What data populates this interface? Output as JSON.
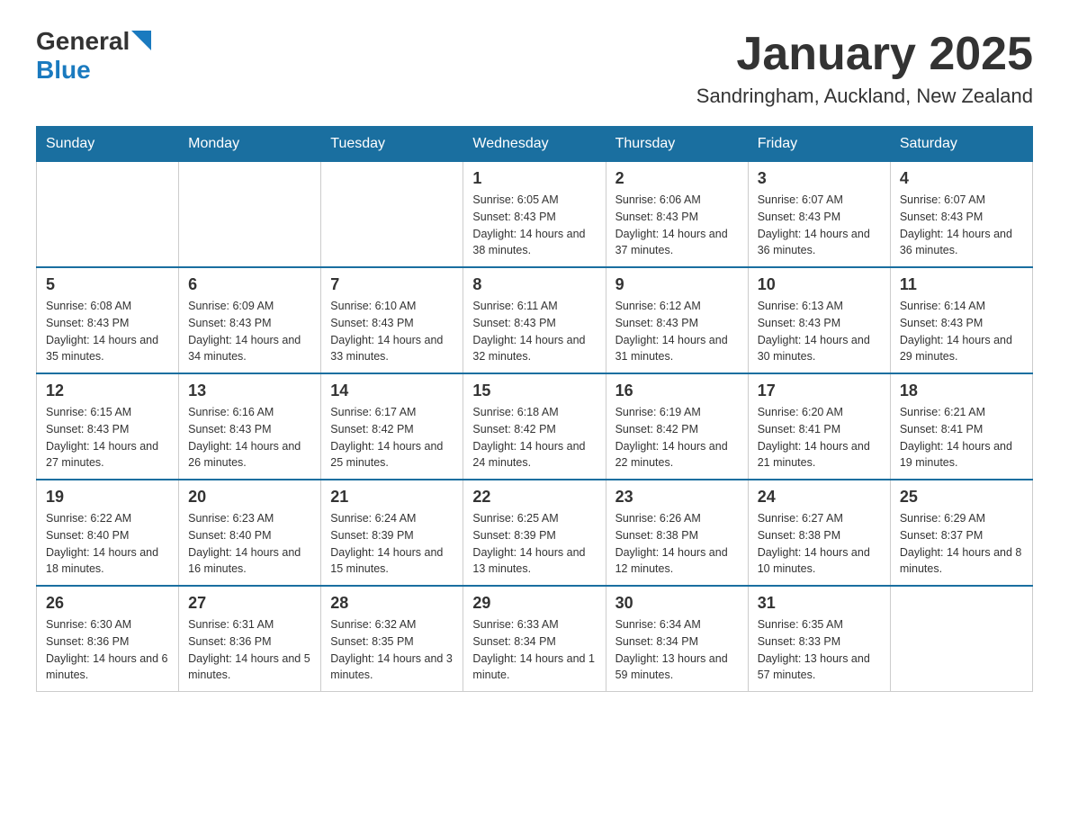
{
  "logo": {
    "general": "General",
    "blue": "Blue"
  },
  "title": "January 2025",
  "subtitle": "Sandringham, Auckland, New Zealand",
  "days": [
    "Sunday",
    "Monday",
    "Tuesday",
    "Wednesday",
    "Thursday",
    "Friday",
    "Saturday"
  ],
  "weeks": [
    [
      {
        "day": "",
        "info": ""
      },
      {
        "day": "",
        "info": ""
      },
      {
        "day": "",
        "info": ""
      },
      {
        "day": "1",
        "info": "Sunrise: 6:05 AM\nSunset: 8:43 PM\nDaylight: 14 hours and 38 minutes."
      },
      {
        "day": "2",
        "info": "Sunrise: 6:06 AM\nSunset: 8:43 PM\nDaylight: 14 hours and 37 minutes."
      },
      {
        "day": "3",
        "info": "Sunrise: 6:07 AM\nSunset: 8:43 PM\nDaylight: 14 hours and 36 minutes."
      },
      {
        "day": "4",
        "info": "Sunrise: 6:07 AM\nSunset: 8:43 PM\nDaylight: 14 hours and 36 minutes."
      }
    ],
    [
      {
        "day": "5",
        "info": "Sunrise: 6:08 AM\nSunset: 8:43 PM\nDaylight: 14 hours and 35 minutes."
      },
      {
        "day": "6",
        "info": "Sunrise: 6:09 AM\nSunset: 8:43 PM\nDaylight: 14 hours and 34 minutes."
      },
      {
        "day": "7",
        "info": "Sunrise: 6:10 AM\nSunset: 8:43 PM\nDaylight: 14 hours and 33 minutes."
      },
      {
        "day": "8",
        "info": "Sunrise: 6:11 AM\nSunset: 8:43 PM\nDaylight: 14 hours and 32 minutes."
      },
      {
        "day": "9",
        "info": "Sunrise: 6:12 AM\nSunset: 8:43 PM\nDaylight: 14 hours and 31 minutes."
      },
      {
        "day": "10",
        "info": "Sunrise: 6:13 AM\nSunset: 8:43 PM\nDaylight: 14 hours and 30 minutes."
      },
      {
        "day": "11",
        "info": "Sunrise: 6:14 AM\nSunset: 8:43 PM\nDaylight: 14 hours and 29 minutes."
      }
    ],
    [
      {
        "day": "12",
        "info": "Sunrise: 6:15 AM\nSunset: 8:43 PM\nDaylight: 14 hours and 27 minutes."
      },
      {
        "day": "13",
        "info": "Sunrise: 6:16 AM\nSunset: 8:43 PM\nDaylight: 14 hours and 26 minutes."
      },
      {
        "day": "14",
        "info": "Sunrise: 6:17 AM\nSunset: 8:42 PM\nDaylight: 14 hours and 25 minutes."
      },
      {
        "day": "15",
        "info": "Sunrise: 6:18 AM\nSunset: 8:42 PM\nDaylight: 14 hours and 24 minutes."
      },
      {
        "day": "16",
        "info": "Sunrise: 6:19 AM\nSunset: 8:42 PM\nDaylight: 14 hours and 22 minutes."
      },
      {
        "day": "17",
        "info": "Sunrise: 6:20 AM\nSunset: 8:41 PM\nDaylight: 14 hours and 21 minutes."
      },
      {
        "day": "18",
        "info": "Sunrise: 6:21 AM\nSunset: 8:41 PM\nDaylight: 14 hours and 19 minutes."
      }
    ],
    [
      {
        "day": "19",
        "info": "Sunrise: 6:22 AM\nSunset: 8:40 PM\nDaylight: 14 hours and 18 minutes."
      },
      {
        "day": "20",
        "info": "Sunrise: 6:23 AM\nSunset: 8:40 PM\nDaylight: 14 hours and 16 minutes."
      },
      {
        "day": "21",
        "info": "Sunrise: 6:24 AM\nSunset: 8:39 PM\nDaylight: 14 hours and 15 minutes."
      },
      {
        "day": "22",
        "info": "Sunrise: 6:25 AM\nSunset: 8:39 PM\nDaylight: 14 hours and 13 minutes."
      },
      {
        "day": "23",
        "info": "Sunrise: 6:26 AM\nSunset: 8:38 PM\nDaylight: 14 hours and 12 minutes."
      },
      {
        "day": "24",
        "info": "Sunrise: 6:27 AM\nSunset: 8:38 PM\nDaylight: 14 hours and 10 minutes."
      },
      {
        "day": "25",
        "info": "Sunrise: 6:29 AM\nSunset: 8:37 PM\nDaylight: 14 hours and 8 minutes."
      }
    ],
    [
      {
        "day": "26",
        "info": "Sunrise: 6:30 AM\nSunset: 8:36 PM\nDaylight: 14 hours and 6 minutes."
      },
      {
        "day": "27",
        "info": "Sunrise: 6:31 AM\nSunset: 8:36 PM\nDaylight: 14 hours and 5 minutes."
      },
      {
        "day": "28",
        "info": "Sunrise: 6:32 AM\nSunset: 8:35 PM\nDaylight: 14 hours and 3 minutes."
      },
      {
        "day": "29",
        "info": "Sunrise: 6:33 AM\nSunset: 8:34 PM\nDaylight: 14 hours and 1 minute."
      },
      {
        "day": "30",
        "info": "Sunrise: 6:34 AM\nSunset: 8:34 PM\nDaylight: 13 hours and 59 minutes."
      },
      {
        "day": "31",
        "info": "Sunrise: 6:35 AM\nSunset: 8:33 PM\nDaylight: 13 hours and 57 minutes."
      },
      {
        "day": "",
        "info": ""
      }
    ]
  ]
}
